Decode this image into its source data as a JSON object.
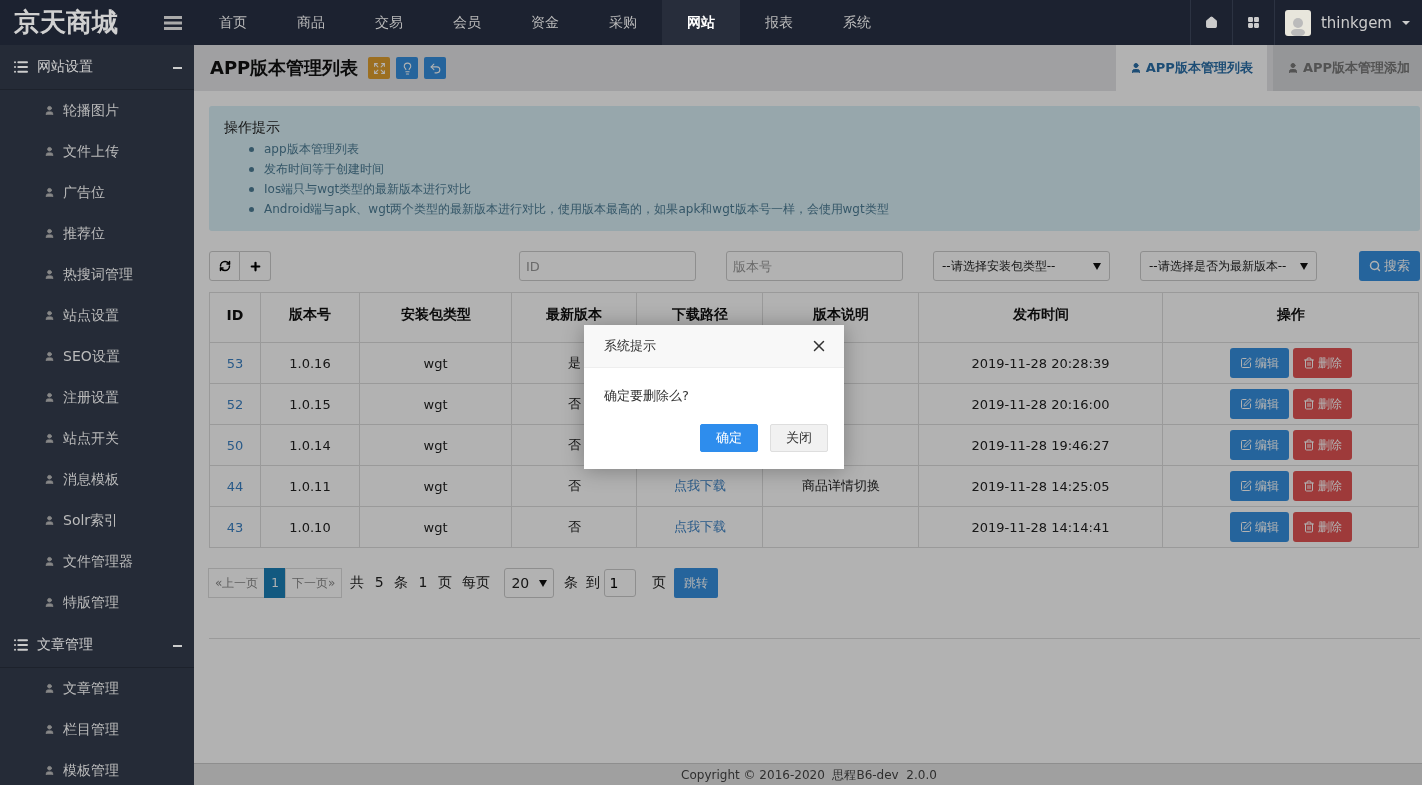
{
  "brand": "京天商城",
  "top_nav": [
    {
      "label": "首页",
      "selected": false
    },
    {
      "label": "商品",
      "selected": false
    },
    {
      "label": "交易",
      "selected": false
    },
    {
      "label": "会员",
      "selected": false
    },
    {
      "label": "资金",
      "selected": false
    },
    {
      "label": "采购",
      "selected": false
    },
    {
      "label": "网站",
      "selected": true
    },
    {
      "label": "报表",
      "selected": false
    },
    {
      "label": "系统",
      "selected": false
    }
  ],
  "user": {
    "name": "thinkgem"
  },
  "sidebar": [
    {
      "title": "网站设置",
      "expanded": true,
      "items": [
        "轮播图片",
        "文件上传",
        "广告位",
        "推荐位",
        "热搜词管理",
        "站点设置",
        "SEO设置",
        "注册设置",
        "站点开关",
        "消息模板",
        "Solr索引",
        "文件管理器",
        "特版管理"
      ]
    },
    {
      "title": "文章管理",
      "expanded": true,
      "items": [
        "文章管理",
        "栏目管理",
        "模板管理"
      ]
    }
  ],
  "page": {
    "title": "APP版本管理列表"
  },
  "tabs": [
    {
      "label": "APP版本管理列表",
      "selected": true
    },
    {
      "label": "APP版本管理添加",
      "selected": false
    }
  ],
  "hint": {
    "title": "操作提示",
    "items": [
      "app版本管理列表",
      "发布时间等于创建时间",
      "Ios端只与wgt类型的最新版本进行对比",
      "Android端与apk、wgt两个类型的最新版本进行对比，使用版本最高的，如果apk和wgt版本号一样，会使用wgt类型"
    ]
  },
  "filters": {
    "id_placeholder": "ID",
    "version_placeholder": "版本号",
    "type_select": "--请选择安装包类型--",
    "latest_select": "--请选择是否为最新版本--",
    "search": "搜索"
  },
  "table": {
    "columns": [
      "ID",
      "版本号",
      "安装包类型",
      "最新版本",
      "下载路径",
      "版本说明",
      "发布时间",
      "操作"
    ],
    "rows": [
      {
        "id": "53",
        "version": "1.0.16",
        "type": "wgt",
        "latest": "是",
        "time": "2019-11-28 20:28:39",
        "edit": "编辑",
        "delete": "删除"
      },
      {
        "id": "52",
        "version": "1.0.15",
        "type": "wgt",
        "latest": "否",
        "time": "2019-11-28 20:16:00",
        "edit": "编辑",
        "delete": "删除"
      },
      {
        "id": "50",
        "version": "1.0.14",
        "type": "wgt",
        "latest": "否",
        "time": "2019-11-28 19:46:27",
        "edit": "编辑",
        "delete": "删除"
      },
      {
        "id": "44",
        "version": "1.0.11",
        "type": "wgt",
        "latest": "否",
        "download": "点我下载",
        "note": "商品详情切换",
        "time": "2019-11-28 14:25:05",
        "edit": "编辑",
        "delete": "删除"
      },
      {
        "id": "43",
        "version": "1.0.10",
        "type": "wgt",
        "latest": "否",
        "download": "点我下载",
        "time": "2019-11-28 14:14:41",
        "edit": "编辑",
        "delete": "删除"
      }
    ]
  },
  "pagination": {
    "prev": "«上一页",
    "pages": [
      {
        "label": "1",
        "selected": true
      }
    ],
    "next": "下一页»",
    "summary": "共 5 条 1 页 每页",
    "page_size": "20",
    "unit": "条",
    "goto": "到",
    "goto_value": "1",
    "page_word": "页",
    "jump": "跳转"
  },
  "footer": "Copyright © 2016-2020  思程B6-dev  2.0.0",
  "dialog": {
    "title": "系统提示",
    "message": "确定要删除么?",
    "confirm": "确定",
    "close": "关闭"
  }
}
